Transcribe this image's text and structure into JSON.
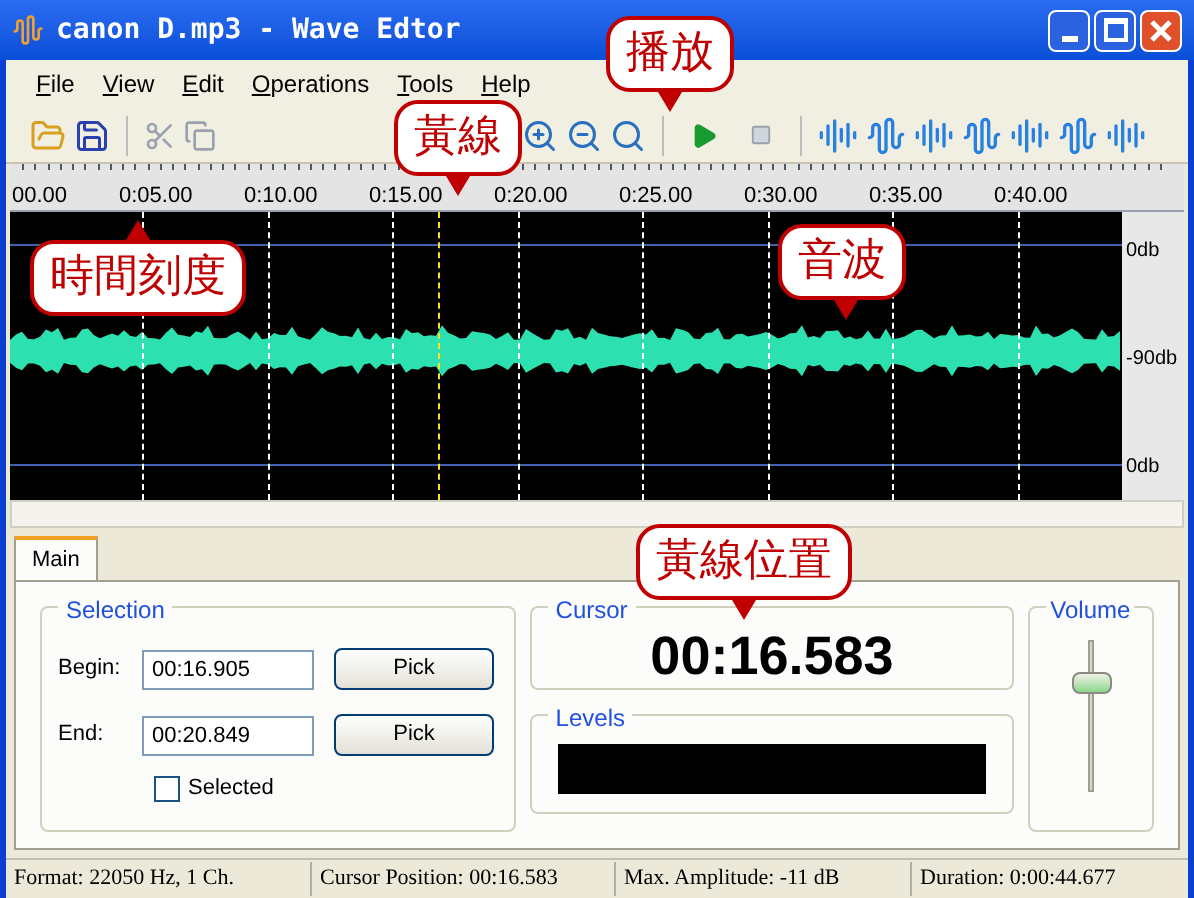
{
  "window": {
    "title": "canon D.mp3 - Wave Edtor"
  },
  "menu": [
    "File",
    "View",
    "Edit",
    "Operations",
    "Tools",
    "Help"
  ],
  "ruler": [
    "00.00",
    "0:05.00",
    "0:10.00",
    "0:15.00",
    "0:20.00",
    "0:25.00",
    "0:30.00",
    "0:35.00",
    "0:40.00"
  ],
  "wave_scale": [
    "0db",
    "-90db",
    "0db"
  ],
  "callouts": [
    {
      "text": "播放",
      "kind": "down"
    },
    {
      "text": "黃線",
      "kind": "down"
    },
    {
      "text": "時間刻度",
      "kind": "up"
    },
    {
      "text": "音波",
      "kind": "downright"
    },
    {
      "text": "黃線位置",
      "kind": "down"
    }
  ],
  "tabs": [
    {
      "label": "Main",
      "selected": true
    }
  ],
  "selection": {
    "title": "Selection",
    "begin_label": "Begin:",
    "begin": "00:16.905",
    "end_label": "End:",
    "end": "00:20.849",
    "pick": [
      "Pick",
      "Pick"
    ],
    "selected_label": "Selected",
    "checked": false
  },
  "cursor": {
    "title": "Cursor",
    "time": "00:16.583"
  },
  "levels": {
    "title": "Levels"
  },
  "volume": {
    "title": "Volume",
    "level": 0.75
  },
  "status_bar": [
    "Format: 22050 Hz, 1 Ch.",
    "Cursor Position: 00:16.583",
    "Max. Amplitude: -11 dB",
    "Duration: 0:00:44.677"
  ]
}
